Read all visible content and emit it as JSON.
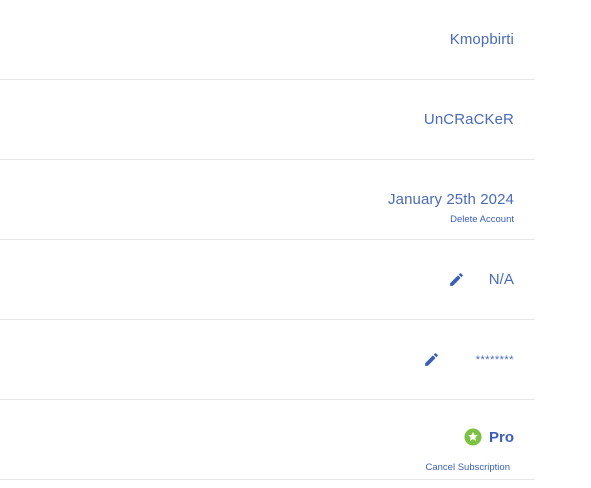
{
  "account": {
    "rows": [
      {
        "value": "Kmopbirti"
      },
      {
        "value": "UnCRaCKeR"
      },
      {
        "value": "January 25th 2024",
        "link": "Delete Account"
      },
      {
        "value": "N/A"
      },
      {
        "value": "********"
      },
      {
        "value": "Pro",
        "link": "Cancel Subscription"
      }
    ]
  },
  "colors": {
    "text_blue": "#4a6bb8",
    "link_blue": "#3b5fb5",
    "badge_green": "#7cc242",
    "divider": "#e8e8e8"
  },
  "icons": {
    "edit": "pencil-icon",
    "plan_badge": "star-badge-icon"
  }
}
